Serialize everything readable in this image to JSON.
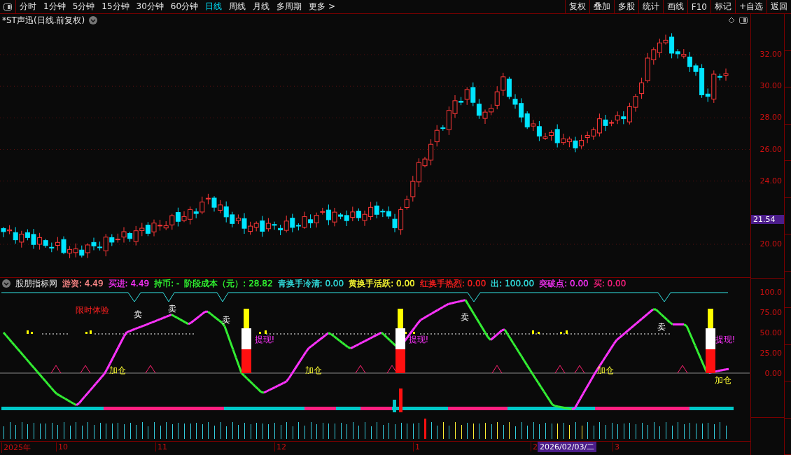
{
  "toolbar": {
    "periods": [
      {
        "label": "分时",
        "selected": false
      },
      {
        "label": "1分钟",
        "selected": false
      },
      {
        "label": "5分钟",
        "selected": false
      },
      {
        "label": "15分钟",
        "selected": false
      },
      {
        "label": "30分钟",
        "selected": false
      },
      {
        "label": "60分钟",
        "selected": false
      },
      {
        "label": "日线",
        "selected": true
      },
      {
        "label": "周线",
        "selected": false
      },
      {
        "label": "月线",
        "selected": false
      },
      {
        "label": "多周期",
        "selected": false
      },
      {
        "label": "更多 >",
        "selected": false
      }
    ],
    "buttons": [
      "复权",
      "叠加",
      "多股",
      "统计",
      "画线",
      "F10",
      "标记",
      "+自选",
      "返回"
    ]
  },
  "price_panel": {
    "title": "*ST声迅(日线.前复权)",
    "yticks": [
      "32.00",
      "30.00",
      "28.00",
      "26.00",
      "24.00",
      "20.00"
    ],
    "last_price": "21.54"
  },
  "indicator_panel": {
    "name": "股朋指标网",
    "legend": [
      {
        "label": "游资: 4.49",
        "color": "#ff8a8a"
      },
      {
        "label": "买进: 4.49",
        "color": "#ff33ff"
      },
      {
        "label": "持币: -",
        "color": "#33ff33"
      },
      {
        "label": "阶段成本（元）: 28.82",
        "color": "#33ff33"
      },
      {
        "label": "青换手冷清: 0.00",
        "color": "#33e5e5"
      },
      {
        "label": "黄换手活跃: 0.00",
        "color": "#ffff33"
      },
      {
        "label": "红换手热烈: 0.00",
        "color": "#ff2020"
      },
      {
        "label": "出: 100.00",
        "color": "#33e5e5"
      },
      {
        "label": "突破点: 0.00",
        "color": "#ff33ff"
      },
      {
        "label": "买: 0.00",
        "color": "#ff2080"
      }
    ],
    "signals": [
      {
        "kind": "promo",
        "text": "限时体验"
      },
      {
        "kind": "sell",
        "text": "卖"
      },
      {
        "kind": "sell",
        "text": "卖"
      },
      {
        "kind": "sell",
        "text": "卖"
      },
      {
        "kind": "sell",
        "text": "卖"
      },
      {
        "kind": "sell",
        "text": "卖"
      },
      {
        "kind": "add",
        "text": "加仓"
      },
      {
        "kind": "add",
        "text": "加仓"
      },
      {
        "kind": "add",
        "text": "加仓"
      },
      {
        "kind": "add",
        "text": "加仓"
      },
      {
        "kind": "cash",
        "text": "提现!"
      },
      {
        "kind": "cash",
        "text": "提现!"
      },
      {
        "kind": "cash",
        "text": "提现!"
      }
    ],
    "yticks": [
      "100.0",
      "75.00",
      "50.00",
      "25.00",
      "0.00"
    ]
  },
  "date_axis": {
    "labels": [
      "2025年",
      "10",
      "11",
      "12",
      "1",
      "2"
    ],
    "cursor_date": "2026/02/03/二",
    "labels_after": [
      "3"
    ]
  }
}
